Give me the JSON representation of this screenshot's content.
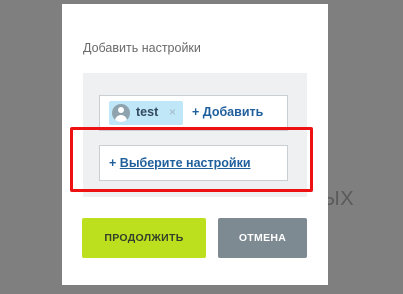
{
  "background": {
    "partial_text": "ЫХ"
  },
  "modal": {
    "title": "Добавить настройки",
    "tag": {
      "label": "test",
      "remove_glyph": "×",
      "icon": "user-avatar-icon"
    },
    "add_link": "+ Добавить",
    "select_link": {
      "plus": "+",
      "label": "Выберите настройки"
    },
    "buttons": {
      "continue": "ПРОДОЛЖИТЬ",
      "cancel": "ОТМЕНА"
    }
  },
  "colors": {
    "overlay": "#7f7f7f",
    "highlight": "#ee1111",
    "link": "#1f5f9c",
    "tag_bg": "#bfe7f7",
    "continue_bg": "#bde01e",
    "cancel_bg": "#7d8a92"
  }
}
